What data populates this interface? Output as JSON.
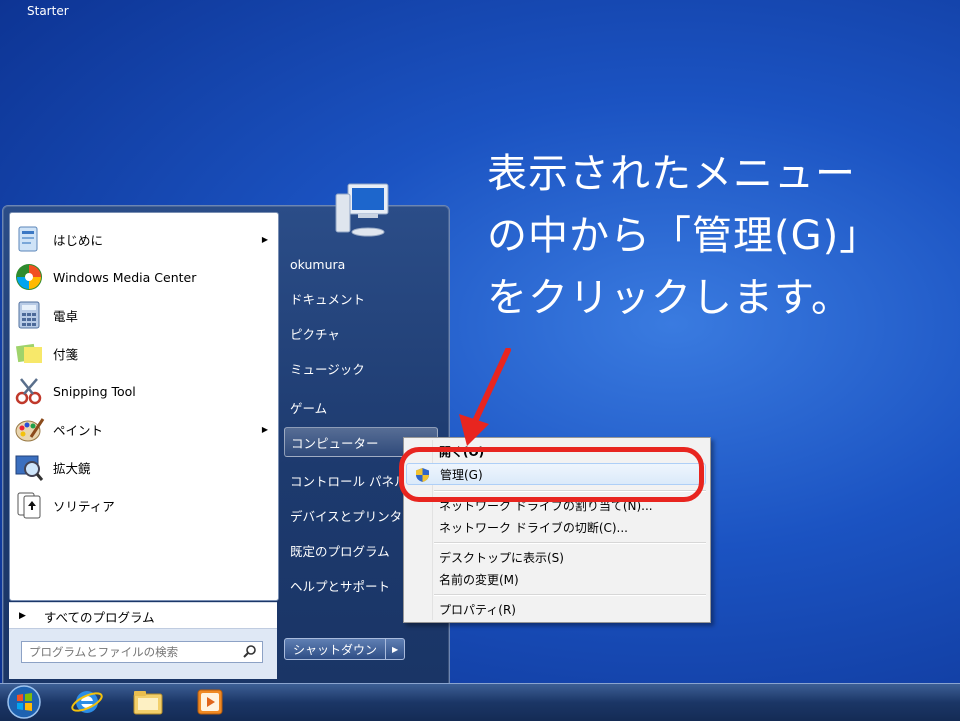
{
  "desktop": {
    "edition_label": "Starter"
  },
  "instruction": {
    "line1": "表示されたメニュー",
    "line2": "の中から「管理(G)」",
    "line3": "をクリックします。"
  },
  "start_menu": {
    "programs": [
      {
        "label": "はじめに",
        "icon": "getting-started-icon",
        "has_submenu": true
      },
      {
        "label": "Windows Media Center",
        "icon": "media-center-icon",
        "has_submenu": false
      },
      {
        "label": "電卓",
        "icon": "calculator-icon",
        "has_submenu": false
      },
      {
        "label": "付箋",
        "icon": "sticky-notes-icon",
        "has_submenu": false
      },
      {
        "label": "Snipping Tool",
        "icon": "snipping-tool-icon",
        "has_submenu": false
      },
      {
        "label": "ペイント",
        "icon": "paint-icon",
        "has_submenu": true
      },
      {
        "label": "拡大鏡",
        "icon": "magnifier-icon",
        "has_submenu": false
      },
      {
        "label": "ソリティア",
        "icon": "solitaire-icon",
        "has_submenu": false
      }
    ],
    "all_programs": "すべてのプログラム",
    "search_placeholder": "プログラムとファイルの検索",
    "right": {
      "user": "okumura",
      "documents": "ドキュメント",
      "pictures": "ピクチャ",
      "music": "ミュージック",
      "games": "ゲーム",
      "computer": "コンピューター",
      "control_panel": "コントロール パネル",
      "devices": "デバイスとプリンター",
      "default_programs": "既定のプログラム",
      "help": "ヘルプとサポート"
    },
    "shutdown": "シャットダウン"
  },
  "context_menu": {
    "open": "開く(O)",
    "manage": "管理(G)",
    "map_drive": "ネットワーク ドライブの割り当て(N)...",
    "disconnect": "ネットワーク ドライブの切断(C)...",
    "show_desktop": "デスクトップに表示(S)",
    "rename": "名前の変更(M)",
    "properties": "プロパティ(R)"
  },
  "colors": {
    "highlight_ring": "#e8251f",
    "desktop": "#1b53c2"
  }
}
